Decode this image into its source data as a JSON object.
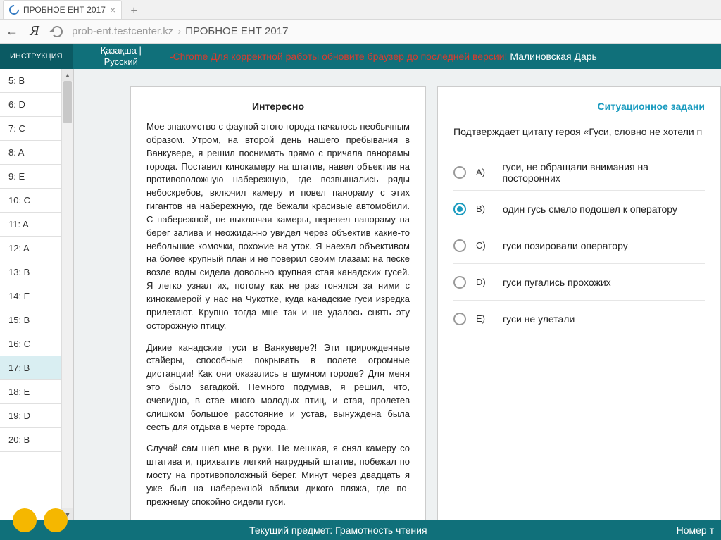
{
  "browser": {
    "tab_title": "ПРОБНОЕ ЕНТ 2017",
    "url_host": "prob-ent.testcenter.kz",
    "url_path": "ПРОБНОЕ ЕНТ 2017"
  },
  "header": {
    "instruction": "ИНСТРУКЦИЯ",
    "lang_kk": "Қазақша |",
    "lang_ru": "Русский",
    "warning": "-Chrome Для корректной работы обновите браузер до последней версии!",
    "user": "Малиновская Дарь"
  },
  "answers": [
    {
      "label": "5: B",
      "active": false
    },
    {
      "label": "6: D",
      "active": false
    },
    {
      "label": "7: C",
      "active": false
    },
    {
      "label": "8: A",
      "active": false
    },
    {
      "label": "9: E",
      "active": false
    },
    {
      "label": "10: C",
      "active": false
    },
    {
      "label": "11: A",
      "active": false
    },
    {
      "label": "12: A",
      "active": false
    },
    {
      "label": "13: B",
      "active": false
    },
    {
      "label": "14: E",
      "active": false
    },
    {
      "label": "15: B",
      "active": false
    },
    {
      "label": "16: C",
      "active": false
    },
    {
      "label": "17: B",
      "active": true
    },
    {
      "label": "18: E",
      "active": false
    },
    {
      "label": "19: D",
      "active": false
    },
    {
      "label": "20: B",
      "active": false
    }
  ],
  "reading": {
    "title": "Интересно",
    "p1": "Мое знакомство с фауной этого города началось необычным образом. Утром, на второй день нашего пребывания в Ванкувере, я решил поснимать прямо с причала панорамы города. Поставил кинокамеру на штатив, навел объектив на противоположную набережную, где возвышались ряды небоскребов, включил камеру и повел панораму с этих гигантов на набережную, где бежали красивые автомобили. С набережной, не выключая камеры, перевел панораму на берег залива и неожиданно увидел через объектив какие-то небольшие комочки, похожие на уток. Я наехал объективом на более крупный план и не поверил своим глазам: на песке возле воды сидела довольно крупная стая канадских гусей. Я легко узнал их, потому как не раз гонялся за ними с кинокамерой у нас на Чукотке, куда канадские гуси изредка прилетают. Крупно тогда мне так и не удалось снять эту осторожную птицу.",
    "p2": "Дикие канадские гуси в Ванкувере?! Эти прирожденные стайеры, способные покрывать в полете огромные дистанции! Как они оказались в шумном городе? Для меня это было загадкой. Немного подумав, я решил, что, очевидно, в стае много молодых птиц, и стая, пролетев слишком большое расстояние и устав, вынуждена была сесть для отдыха в черте города.",
    "p3": "Случай сам шел мне в руки. Не мешкая, я снял камеру со штатива и, прихватив легкий нагрудный штатив, побежал по мосту на противоположный берег. Минут через двадцать я уже был на набережной вблизи дикого пляжа, где по-прежнему спокойно сидели гуси."
  },
  "question": {
    "section": "Ситуационное задани",
    "text": "Подтверждает цитату героя  «Гуси, словно не хотели п",
    "options": [
      {
        "letter": "A)",
        "text": "гуси, не обращали внимания на посторонних",
        "checked": false
      },
      {
        "letter": "B)",
        "text": "один гусь смело подошел к оператору",
        "checked": true
      },
      {
        "letter": "C)",
        "text": "гуси позировали оператору",
        "checked": false
      },
      {
        "letter": "D)",
        "text": "гуси пугались прохожих",
        "checked": false
      },
      {
        "letter": "E)",
        "text": "гуси не улетали",
        "checked": false
      }
    ]
  },
  "footer": {
    "subject": "Текущий предмет: Грамотность чтения",
    "right": "Номер т"
  }
}
